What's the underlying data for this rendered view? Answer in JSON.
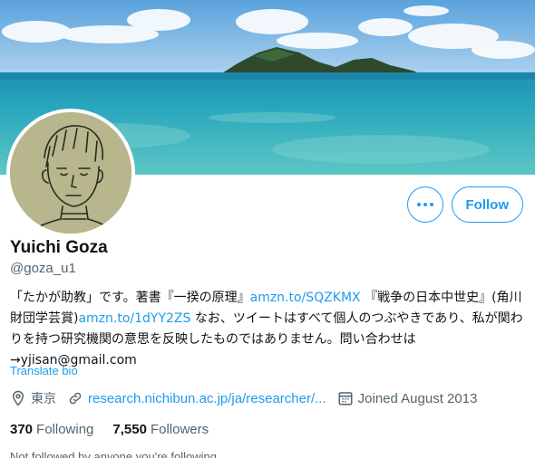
{
  "profile": {
    "name": "Yuichi Goza",
    "handle": "@goza_u1",
    "bio": {
      "part1": "「たかが助教」です。著書『一揆の原理』",
      "link1": "amzn.to/SQZKMX",
      "part2": " 『戦争の日本中世史』(角川財団学芸賞)",
      "link2": "amzn.to/1dYY2ZS",
      "part3": " なお、ツイートはすべて個人のつぶやきであり、私が関わりを持つ研究機関の意思を反映したものではありません。問い合わせは→yjisan@gmail.com"
    },
    "translate_label": "Translate bio",
    "location": "東京",
    "website": "research.nichibun.ac.jp/ja/researcher/...",
    "joined": "Joined August 2013",
    "following_count": "370",
    "following_label": "Following",
    "followers_count": "7,550",
    "followers_label": "Followers",
    "followed_note": "Not followed by anyone you're following"
  },
  "actions": {
    "follow_label": "Follow",
    "more_icon": "more-icon"
  },
  "icons": {
    "location": "location-pin-icon",
    "link": "link-icon",
    "calendar": "calendar-icon"
  },
  "colors": {
    "accent": "#1d9bf0",
    "secondary_text": "#536471",
    "primary_text": "#0f1419"
  }
}
